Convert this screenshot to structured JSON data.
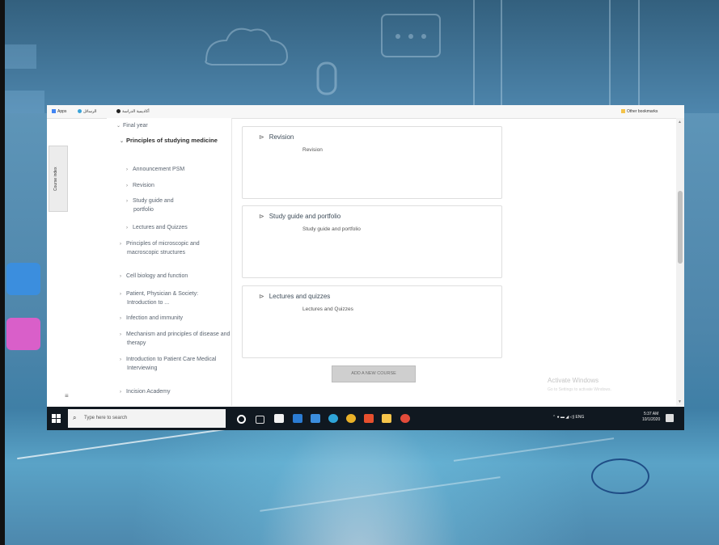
{
  "bookmarks": [
    {
      "label": "Apps",
      "icon": "apps-grid-icon",
      "color": "#4285f4"
    },
    {
      "label": "الرسائل",
      "icon": "globe-icon",
      "color": "#3aa3d8"
    },
    {
      "label": "أكاديمية الدراسة",
      "icon": "bookmark-icon",
      "color": "#222222"
    },
    {
      "label": "Other bookmarks",
      "icon": "folder-icon",
      "color": "#f3c34a"
    }
  ],
  "drawer": {
    "label": "Course index"
  },
  "nav": {
    "items": [
      {
        "label": "Final year",
        "level": 0,
        "bold": false
      },
      {
        "label": "Principles of studying medicine",
        "level": 1,
        "bold": true
      },
      {
        "label": "Announcement PSM",
        "level": 2,
        "bold": false
      },
      {
        "label": "Revision",
        "level": 2,
        "bold": false
      },
      {
        "label": "Study guide and portfolio",
        "level": 2,
        "bold": false
      },
      {
        "label": "Lectures and Quizzes",
        "level": 2,
        "bold": false
      },
      {
        "label": "Principles of microscopic and macroscopic structures",
        "level": 1,
        "bold": false
      },
      {
        "label": "Cell biology and function",
        "level": 1,
        "bold": false
      },
      {
        "label": "Patient, Physician & Society: Introduction to ...",
        "level": 1,
        "bold": false
      },
      {
        "label": "Infection and immunity",
        "level": 1,
        "bold": false
      },
      {
        "label": "Mechanism and principles of disease and therapy",
        "level": 1,
        "bold": false
      },
      {
        "label": "Introduction to Patient Care Medical Interviewing",
        "level": 1,
        "bold": false
      },
      {
        "label": "Incision Academy",
        "level": 1,
        "bold": false
      }
    ]
  },
  "sections": [
    {
      "title": "Revision",
      "description": "Revision"
    },
    {
      "title": "Study guide and portfolio",
      "description": "Study guide and portfolio"
    },
    {
      "title": "Lectures and quizzes",
      "description": "Lectures and Quizzes"
    }
  ],
  "add_course_label": "ADD A NEW COURSE",
  "watermark": {
    "title": "Activate Windows",
    "subtitle": "Go to Settings to activate Windows."
  },
  "taskbar": {
    "search_placeholder": "Type here to search",
    "tray_text": "ENG",
    "time": "5:37 AM",
    "date": "10/1/2020",
    "app_icons": [
      {
        "name": "cortana-icon",
        "color": "#ffffff"
      },
      {
        "name": "task-view-icon",
        "color": "#dddddd"
      },
      {
        "name": "store-icon",
        "color": "#f2f2f2"
      },
      {
        "name": "mail-icon",
        "color": "#2b7cd3"
      },
      {
        "name": "photos-icon",
        "color": "#3b8ede"
      },
      {
        "name": "edge-icon",
        "color": "#2ea4d8"
      },
      {
        "name": "chrome-icon",
        "color": "#e9b128"
      },
      {
        "name": "office-icon",
        "color": "#e6502e"
      },
      {
        "name": "explorer-icon",
        "color": "#f5c44b"
      },
      {
        "name": "media-icon",
        "color": "#e24b3a"
      }
    ]
  },
  "colors": {
    "accent_circle": "#1f4d86",
    "taskbar": "#101820"
  }
}
